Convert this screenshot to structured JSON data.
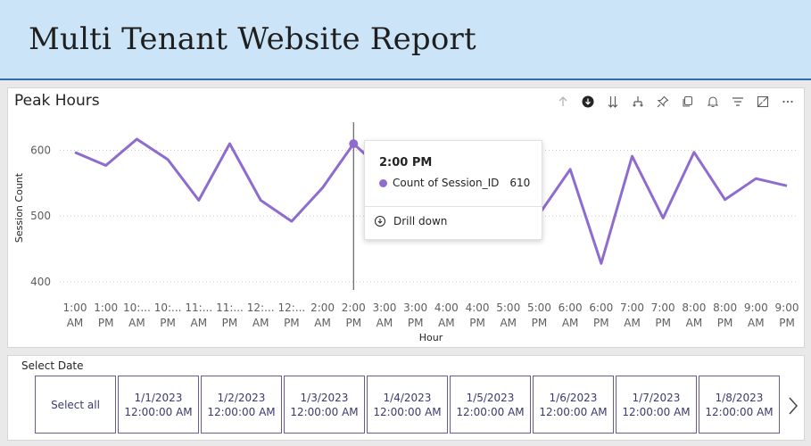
{
  "header": {
    "title": "Multi Tenant Website Report"
  },
  "chart_visual": {
    "title": "Peak Hours",
    "toolbar_icons": [
      "drill-up-icon",
      "drill-down-mode-icon",
      "expand-next-level-icon",
      "expand-hierarchy-icon",
      "pin-icon",
      "copy-icon",
      "bell-icon",
      "filter-icon",
      "focus-mode-icon",
      "more-options-icon"
    ]
  },
  "tooltip": {
    "title": "2:00 PM",
    "series_label": "Count of Session_ID",
    "series_value": "610",
    "series_color": "#8e6ccf",
    "action_label": "Drill down"
  },
  "chart_data": {
    "type": "line",
    "xlabel": "Hour",
    "ylabel": "Session Count",
    "categories": [
      [
        "1:00",
        "AM"
      ],
      [
        "1:00",
        "PM"
      ],
      [
        "10:...",
        "AM"
      ],
      [
        "10:...",
        "PM"
      ],
      [
        "11:...",
        "AM"
      ],
      [
        "11:...",
        "PM"
      ],
      [
        "12:...",
        "AM"
      ],
      [
        "12:...",
        "PM"
      ],
      [
        "2:00",
        "AM"
      ],
      [
        "2:00",
        "PM"
      ],
      [
        "3:00",
        "AM"
      ],
      [
        "3:00",
        "PM"
      ],
      [
        "4:00",
        "AM"
      ],
      [
        "4:00",
        "PM"
      ],
      [
        "5:00",
        "AM"
      ],
      [
        "5:00",
        "PM"
      ],
      [
        "6:00",
        "AM"
      ],
      [
        "6:00",
        "PM"
      ],
      [
        "7:00",
        "AM"
      ],
      [
        "7:00",
        "PM"
      ],
      [
        "8:00",
        "AM"
      ],
      [
        "8:00",
        "PM"
      ],
      [
        "9:00",
        "AM"
      ],
      [
        "9:00",
        "PM"
      ]
    ],
    "series": [
      {
        "values": [
          597,
          577,
          617,
          586,
          524,
          610,
          524,
          492,
          543,
          610,
          567,
          577,
          547,
          540,
          528,
          503,
          571,
          428,
          591,
          497,
          597,
          525,
          557,
          546
        ],
        "color": "#8e6ccf"
      }
    ],
    "yticks": [
      400,
      500,
      600
    ],
    "ylim": [
      385,
      640
    ],
    "highlight_index": 9,
    "grid": true
  },
  "slicer": {
    "title": "Select Date",
    "tiles": [
      {
        "line1": "Select all",
        "line2": ""
      },
      {
        "line1": "1/1/2023",
        "line2": "12:00:00 AM"
      },
      {
        "line1": "1/2/2023",
        "line2": "12:00:00 AM"
      },
      {
        "line1": "1/3/2023",
        "line2": "12:00:00 AM"
      },
      {
        "line1": "1/4/2023",
        "line2": "12:00:00 AM"
      },
      {
        "line1": "1/5/2023",
        "line2": "12:00:00 AM"
      },
      {
        "line1": "1/6/2023",
        "line2": "12:00:00 AM"
      },
      {
        "line1": "1/7/2023",
        "line2": "12:00:00 AM"
      },
      {
        "line1": "1/8/2023",
        "line2": "12:00:00 AM"
      }
    ]
  }
}
